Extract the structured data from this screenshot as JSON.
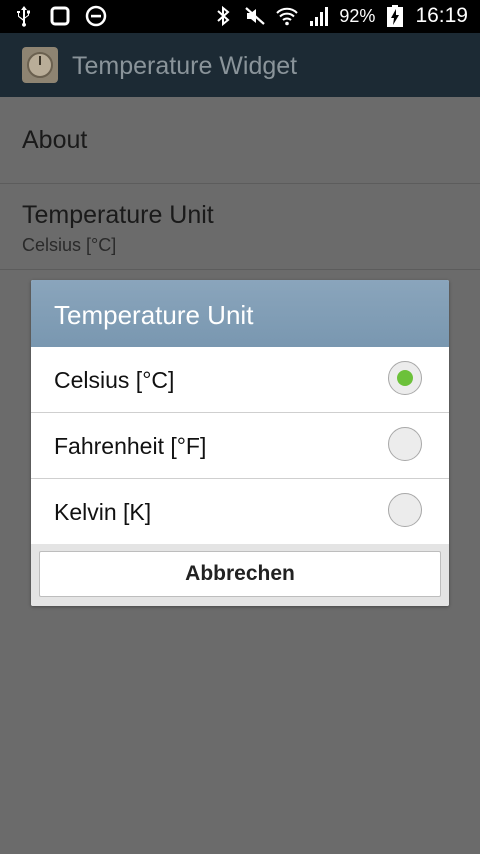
{
  "status_bar": {
    "battery_text": "92%",
    "time": "16:19",
    "icons": [
      "usb-icon",
      "screenshot-icon",
      "do-not-disturb-icon",
      "bluetooth-icon",
      "mute-icon",
      "wifi-icon",
      "signal-icon",
      "battery-charging-icon"
    ]
  },
  "action_bar": {
    "title": "Temperature Widget",
    "icon": "thermometer-dial-icon"
  },
  "settings": {
    "items": [
      {
        "title": "About"
      },
      {
        "title": "Temperature Unit",
        "summary": "Celsius [°C]"
      }
    ]
  },
  "dialog": {
    "title": "Temperature Unit",
    "options": [
      {
        "label": "Celsius [°C]",
        "selected": true
      },
      {
        "label": "Fahrenheit [°F]",
        "selected": false
      },
      {
        "label": "Kelvin [K]",
        "selected": false
      }
    ],
    "cancel_label": "Abbrechen"
  },
  "colors": {
    "dialog_header": "#7f9db5",
    "radio_selected": "#6cc13a",
    "action_bar": "#1c2a34",
    "dim_background": "#6b6b6b"
  }
}
